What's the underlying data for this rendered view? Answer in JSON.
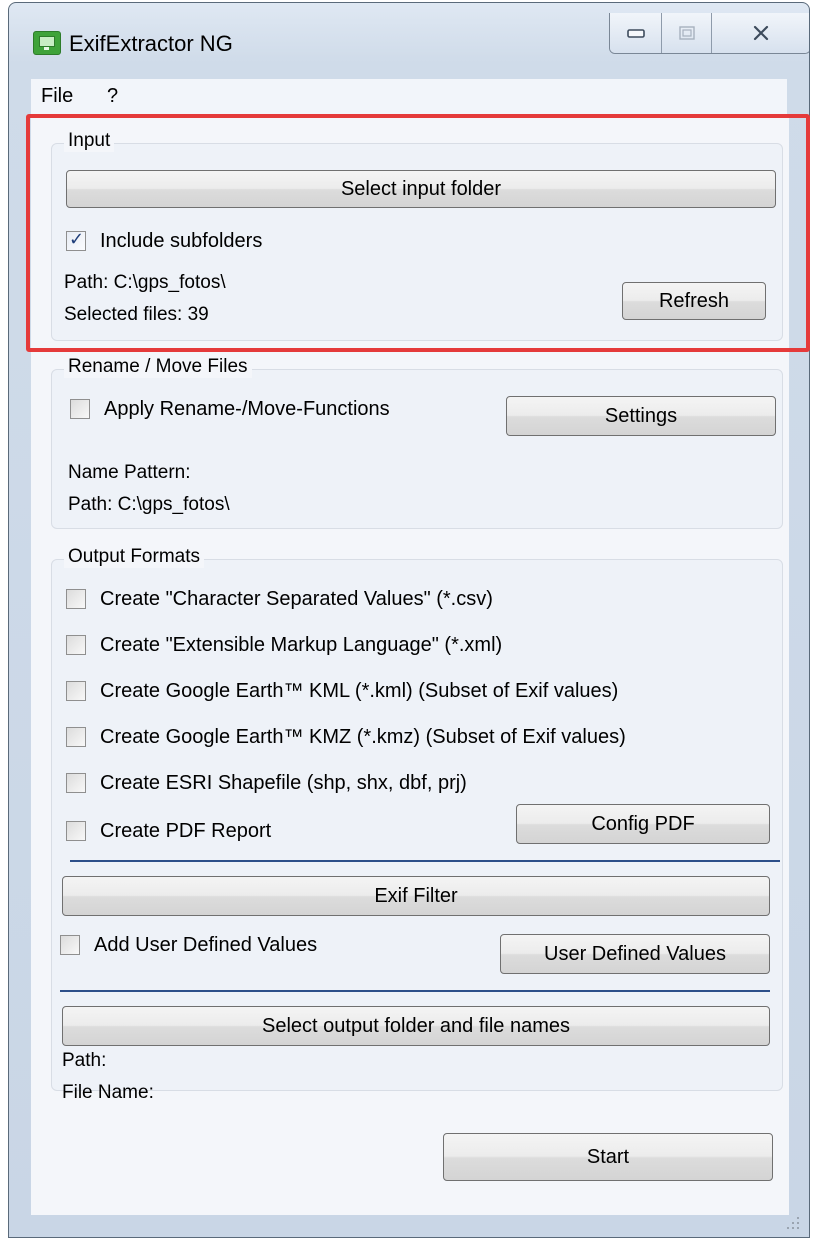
{
  "window": {
    "title": "ExifExtractor NG"
  },
  "menu": {
    "items": [
      {
        "label": "File"
      },
      {
        "label": "?"
      }
    ]
  },
  "input_group": {
    "legend": "Input",
    "select_folder_button": "Select input folder",
    "include_subfolders": {
      "label": "Include subfolders",
      "checked": true
    },
    "path": "Path: C:\\gps_fotos\\",
    "selected_files": "Selected files: 39",
    "refresh_button": "Refresh"
  },
  "rename_group": {
    "legend": "Rename / Move Files",
    "apply_checkbox": {
      "label": "Apply Rename-/Move-Functions",
      "checked": false
    },
    "settings_button": "Settings",
    "name_pattern": "Name Pattern:",
    "path": "Path: C:\\gps_fotos\\"
  },
  "output_group": {
    "legend": "Output Formats",
    "formats": [
      {
        "label": "Create \"Character Separated Values\" (*.csv)",
        "checked": false
      },
      {
        "label": "Create \"Extensible Markup Language\" (*.xml)",
        "checked": false
      },
      {
        "label": "Create Google Earth™ KML (*.kml) (Subset of Exif values)",
        "checked": false
      },
      {
        "label": "Create Google Earth™ KMZ (*.kmz) (Subset of Exif values)",
        "checked": false
      },
      {
        "label": "Create ESRI Shapefile (shp, shx, dbf, prj)",
        "checked": false
      },
      {
        "label": "Create PDF Report",
        "checked": false
      }
    ],
    "config_pdf_button": "Config PDF",
    "exif_filter_button": "Exif Filter",
    "user_values_checkbox": {
      "label": "Add User Defined Values",
      "checked": false
    },
    "user_values_button": "User Defined Values",
    "select_output_button": "Select output folder and file names",
    "path_label": "Path:",
    "file_name_label": "File Name:"
  },
  "start_button": "Start",
  "colors": {
    "highlight": "#e53a3a",
    "separator": "#2d4f8a",
    "app_icon": "#3fa33a"
  }
}
